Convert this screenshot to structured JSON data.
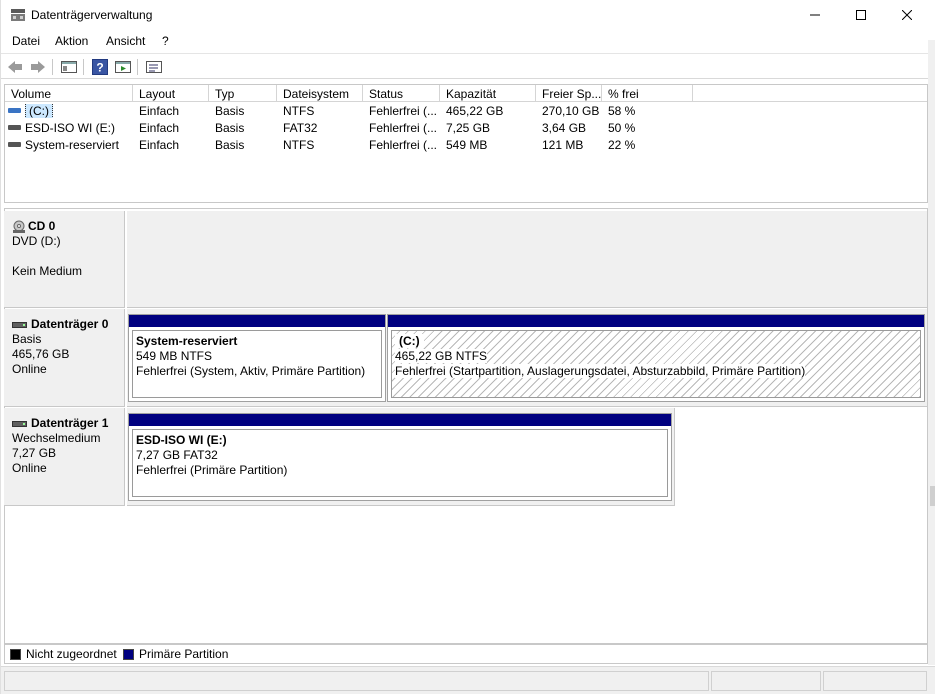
{
  "window": {
    "title": "Datenträgerverwaltung",
    "controls": {
      "minimize": "—",
      "maximize": "☐",
      "close": "✕"
    }
  },
  "menu": [
    "Datei",
    "Aktion",
    "Ansicht",
    "?"
  ],
  "toolbar_icons": [
    "back-icon",
    "forward-icon",
    "console-tree-icon",
    "help-icon",
    "action-pane-icon",
    "properties-icon"
  ],
  "volume_list": {
    "columns": [
      "Volume",
      "Layout",
      "Typ",
      "Dateisystem",
      "Status",
      "Kapazität",
      "Freier Sp...",
      "% frei"
    ],
    "rows": [
      {
        "volume": "(C:)",
        "layout": "Einfach",
        "type": "Basis",
        "fs": "NTFS",
        "status": "Fehlerfrei (...",
        "capacity": "465,22 GB",
        "free": "270,10 GB",
        "pct": "58 %",
        "selected": true
      },
      {
        "volume": "ESD-ISO  WI (E:)",
        "layout": "Einfach",
        "type": "Basis",
        "fs": "FAT32",
        "status": "Fehlerfrei (...",
        "capacity": "7,25 GB",
        "free": "3,64 GB",
        "pct": "50 %",
        "selected": false
      },
      {
        "volume": "System-reserviert",
        "layout": "Einfach",
        "type": "Basis",
        "fs": "NTFS",
        "status": "Fehlerfrei (...",
        "capacity": "549 MB",
        "free": "121 MB",
        "pct": "22 %",
        "selected": false
      }
    ]
  },
  "disks": [
    {
      "name": "CD 0",
      "line1": "DVD (D:)",
      "line2": "",
      "line3": "Kein Medium"
    },
    {
      "name": "Datenträger 0",
      "line1": "Basis",
      "line2": "465,76 GB",
      "line3": "Online"
    },
    {
      "name": "Datenträger 1",
      "line1": "Wechselmedium",
      "line2": "7,27 GB",
      "line3": "Online"
    }
  ],
  "partitions": {
    "disk0_p1": {
      "name": "System-reserviert",
      "size": "549 MB NTFS",
      "status": "Fehlerfrei (System, Aktiv, Primäre Partition)"
    },
    "disk0_p2": {
      "name": "(C:)",
      "size": "465,22 GB NTFS",
      "status": "Fehlerfrei (Startpartition, Auslagerungsdatei, Absturzabbild, Primäre Partition)"
    },
    "disk1_p1": {
      "name": "ESD-ISO  WI  (E:)",
      "size": "7,27 GB FAT32",
      "status": "Fehlerfrei (Primäre Partition)"
    }
  },
  "legend": [
    {
      "label": "Nicht zugeordnet",
      "color": "#000000"
    },
    {
      "label": "Primäre Partition",
      "color": "#000080"
    }
  ],
  "colors": {
    "primary_partition": "#000080",
    "unallocated": "#000000",
    "selection": "#cce8ff"
  }
}
